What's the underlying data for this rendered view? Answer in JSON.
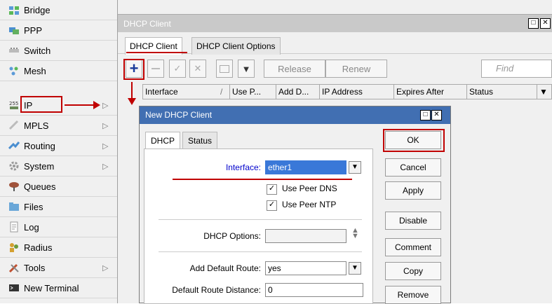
{
  "sidebar": {
    "items": [
      {
        "label": "Bridge",
        "icon": "bridge-icon",
        "submenu": false
      },
      {
        "label": "PPP",
        "icon": "ppp-icon",
        "submenu": false
      },
      {
        "label": "Switch",
        "icon": "switch-icon",
        "submenu": false
      },
      {
        "label": "Mesh",
        "icon": "mesh-icon",
        "submenu": false
      },
      {
        "label": "IP",
        "icon": "ip-icon",
        "submenu": true
      },
      {
        "label": "MPLS",
        "icon": "mpls-icon",
        "submenu": true
      },
      {
        "label": "Routing",
        "icon": "routing-icon",
        "submenu": true
      },
      {
        "label": "System",
        "icon": "system-icon",
        "submenu": true
      },
      {
        "label": "Queues",
        "icon": "queues-icon",
        "submenu": false
      },
      {
        "label": "Files",
        "icon": "files-icon",
        "submenu": false
      },
      {
        "label": "Log",
        "icon": "log-icon",
        "submenu": false
      },
      {
        "label": "Radius",
        "icon": "radius-icon",
        "submenu": false
      },
      {
        "label": "Tools",
        "icon": "tools-icon",
        "submenu": true
      },
      {
        "label": "New Terminal",
        "icon": "terminal-icon",
        "submenu": false
      }
    ],
    "submenu_glyph": "▷"
  },
  "window": {
    "title": "DHCP Client",
    "tabs": [
      "DHCP Client",
      "DHCP Client Options"
    ],
    "toolbar": {
      "release": "Release",
      "renew": "Renew",
      "find_placeholder": "Find"
    },
    "columns": [
      "Interface",
      "Use P...",
      "Add D...",
      "IP Address",
      "Expires After",
      "Status"
    ],
    "sort_glyph": "/"
  },
  "dialog": {
    "title": "New DHCP Client",
    "tabs": [
      "DHCP",
      "Status"
    ],
    "fields": {
      "interface_label": "Interface:",
      "interface_value": "ether1",
      "use_peer_dns": "Use Peer DNS",
      "use_peer_ntp": "Use Peer NTP",
      "dhcp_options_label": "DHCP Options:",
      "dhcp_options_value": "",
      "add_default_route_label": "Add Default Route:",
      "add_default_route_value": "yes",
      "default_route_distance_label": "Default Route Distance:",
      "default_route_distance_value": "0"
    },
    "buttons": [
      "OK",
      "Cancel",
      "Apply",
      "Disable",
      "Comment",
      "Copy",
      "Remove"
    ]
  },
  "colors": {
    "highlight_red": "#c00000",
    "dialog_title": "#416fb2",
    "link_blue": "#0000cc",
    "selected_field": "#3a78d8"
  }
}
